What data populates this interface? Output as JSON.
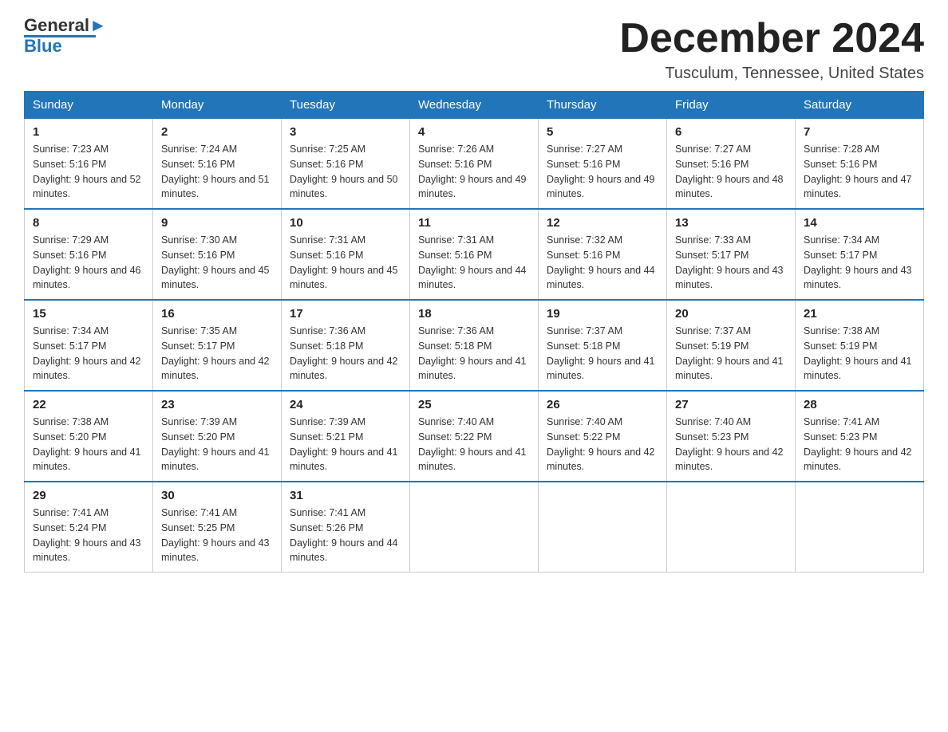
{
  "header": {
    "logo_text_black": "General",
    "logo_text_blue": "Blue",
    "month": "December 2024",
    "location": "Tusculum, Tennessee, United States"
  },
  "weekdays": [
    "Sunday",
    "Monday",
    "Tuesday",
    "Wednesday",
    "Thursday",
    "Friday",
    "Saturday"
  ],
  "weeks": [
    [
      {
        "day": "1",
        "sunrise": "7:23 AM",
        "sunset": "5:16 PM",
        "daylight": "9 hours and 52 minutes."
      },
      {
        "day": "2",
        "sunrise": "7:24 AM",
        "sunset": "5:16 PM",
        "daylight": "9 hours and 51 minutes."
      },
      {
        "day": "3",
        "sunrise": "7:25 AM",
        "sunset": "5:16 PM",
        "daylight": "9 hours and 50 minutes."
      },
      {
        "day": "4",
        "sunrise": "7:26 AM",
        "sunset": "5:16 PM",
        "daylight": "9 hours and 49 minutes."
      },
      {
        "day": "5",
        "sunrise": "7:27 AM",
        "sunset": "5:16 PM",
        "daylight": "9 hours and 49 minutes."
      },
      {
        "day": "6",
        "sunrise": "7:27 AM",
        "sunset": "5:16 PM",
        "daylight": "9 hours and 48 minutes."
      },
      {
        "day": "7",
        "sunrise": "7:28 AM",
        "sunset": "5:16 PM",
        "daylight": "9 hours and 47 minutes."
      }
    ],
    [
      {
        "day": "8",
        "sunrise": "7:29 AM",
        "sunset": "5:16 PM",
        "daylight": "9 hours and 46 minutes."
      },
      {
        "day": "9",
        "sunrise": "7:30 AM",
        "sunset": "5:16 PM",
        "daylight": "9 hours and 45 minutes."
      },
      {
        "day": "10",
        "sunrise": "7:31 AM",
        "sunset": "5:16 PM",
        "daylight": "9 hours and 45 minutes."
      },
      {
        "day": "11",
        "sunrise": "7:31 AM",
        "sunset": "5:16 PM",
        "daylight": "9 hours and 44 minutes."
      },
      {
        "day": "12",
        "sunrise": "7:32 AM",
        "sunset": "5:16 PM",
        "daylight": "9 hours and 44 minutes."
      },
      {
        "day": "13",
        "sunrise": "7:33 AM",
        "sunset": "5:17 PM",
        "daylight": "9 hours and 43 minutes."
      },
      {
        "day": "14",
        "sunrise": "7:34 AM",
        "sunset": "5:17 PM",
        "daylight": "9 hours and 43 minutes."
      }
    ],
    [
      {
        "day": "15",
        "sunrise": "7:34 AM",
        "sunset": "5:17 PM",
        "daylight": "9 hours and 42 minutes."
      },
      {
        "day": "16",
        "sunrise": "7:35 AM",
        "sunset": "5:17 PM",
        "daylight": "9 hours and 42 minutes."
      },
      {
        "day": "17",
        "sunrise": "7:36 AM",
        "sunset": "5:18 PM",
        "daylight": "9 hours and 42 minutes."
      },
      {
        "day": "18",
        "sunrise": "7:36 AM",
        "sunset": "5:18 PM",
        "daylight": "9 hours and 41 minutes."
      },
      {
        "day": "19",
        "sunrise": "7:37 AM",
        "sunset": "5:18 PM",
        "daylight": "9 hours and 41 minutes."
      },
      {
        "day": "20",
        "sunrise": "7:37 AM",
        "sunset": "5:19 PM",
        "daylight": "9 hours and 41 minutes."
      },
      {
        "day": "21",
        "sunrise": "7:38 AM",
        "sunset": "5:19 PM",
        "daylight": "9 hours and 41 minutes."
      }
    ],
    [
      {
        "day": "22",
        "sunrise": "7:38 AM",
        "sunset": "5:20 PM",
        "daylight": "9 hours and 41 minutes."
      },
      {
        "day": "23",
        "sunrise": "7:39 AM",
        "sunset": "5:20 PM",
        "daylight": "9 hours and 41 minutes."
      },
      {
        "day": "24",
        "sunrise": "7:39 AM",
        "sunset": "5:21 PM",
        "daylight": "9 hours and 41 minutes."
      },
      {
        "day": "25",
        "sunrise": "7:40 AM",
        "sunset": "5:22 PM",
        "daylight": "9 hours and 41 minutes."
      },
      {
        "day": "26",
        "sunrise": "7:40 AM",
        "sunset": "5:22 PM",
        "daylight": "9 hours and 42 minutes."
      },
      {
        "day": "27",
        "sunrise": "7:40 AM",
        "sunset": "5:23 PM",
        "daylight": "9 hours and 42 minutes."
      },
      {
        "day": "28",
        "sunrise": "7:41 AM",
        "sunset": "5:23 PM",
        "daylight": "9 hours and 42 minutes."
      }
    ],
    [
      {
        "day": "29",
        "sunrise": "7:41 AM",
        "sunset": "5:24 PM",
        "daylight": "9 hours and 43 minutes."
      },
      {
        "day": "30",
        "sunrise": "7:41 AM",
        "sunset": "5:25 PM",
        "daylight": "9 hours and 43 minutes."
      },
      {
        "day": "31",
        "sunrise": "7:41 AM",
        "sunset": "5:26 PM",
        "daylight": "9 hours and 44 minutes."
      },
      null,
      null,
      null,
      null
    ]
  ]
}
